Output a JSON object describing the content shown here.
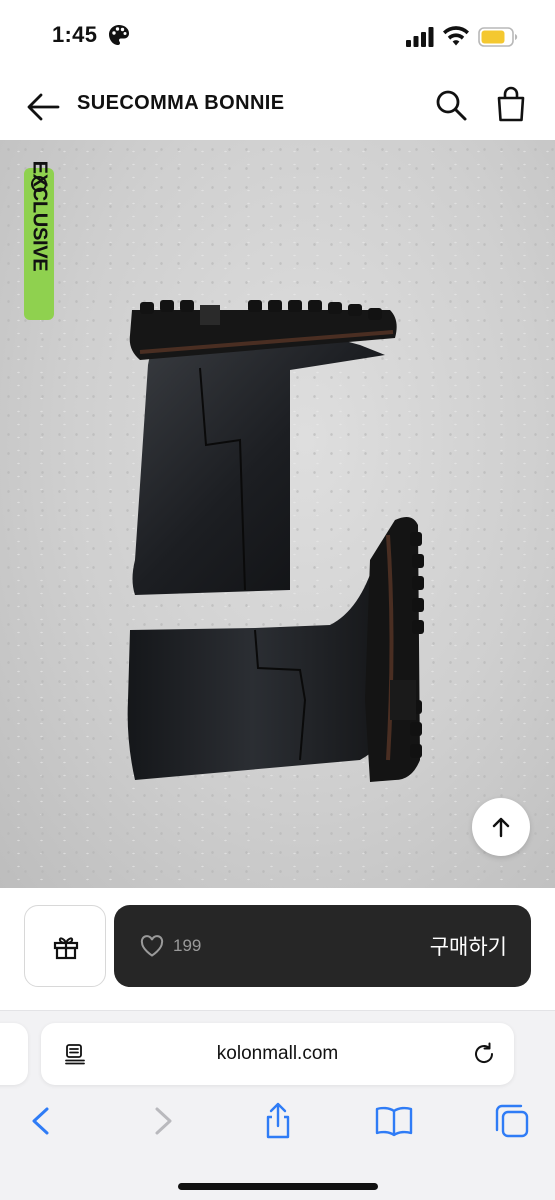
{
  "status_bar": {
    "time": "1:45"
  },
  "header": {
    "title": "SUECOMMA BONNIE"
  },
  "product": {
    "badge_label": "EXCLUSIVE"
  },
  "action_bar": {
    "like_count": "199",
    "buy_label": "구매하기"
  },
  "browser": {
    "url": "kolonmall.com"
  },
  "colors": {
    "badge_green": "#8fd14f",
    "buy_bar": "#262626",
    "browser_accent": "#2f7cf6"
  },
  "icons": [
    "palette-icon",
    "signal-icon",
    "wifi-icon",
    "battery-icon",
    "back-arrow-icon",
    "search-icon",
    "shopping-bag-icon",
    "arrow-up-icon",
    "gift-icon",
    "heart-icon",
    "reader-icon",
    "reload-icon",
    "chevron-left-icon",
    "chevron-right-icon",
    "share-icon",
    "book-icon",
    "tabs-icon"
  ]
}
